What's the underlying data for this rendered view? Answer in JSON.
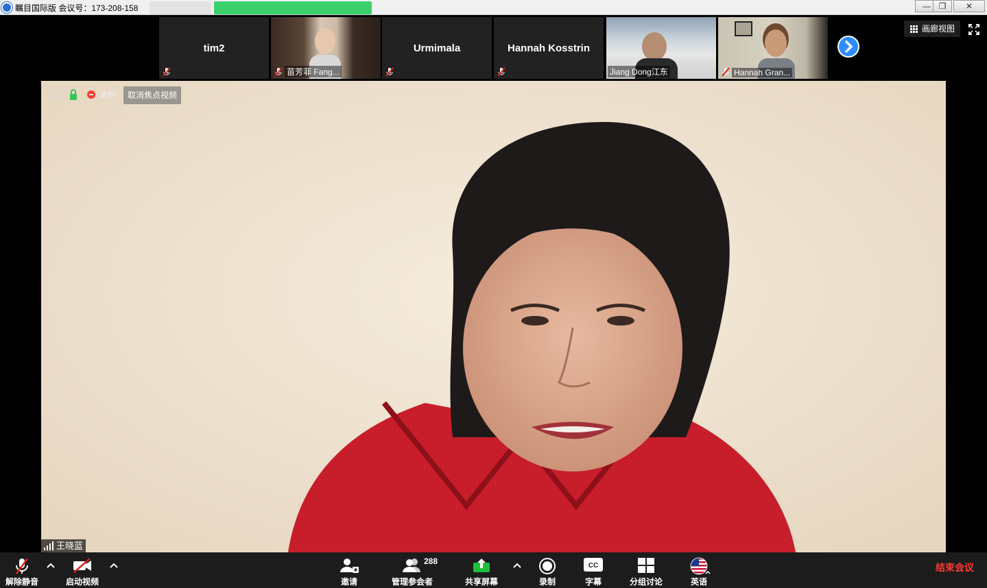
{
  "window": {
    "title": "瞩目国际版 会议号：173-208-158",
    "buttons": {
      "minimize": "—",
      "restore": "❐",
      "close": "✕"
    }
  },
  "strip": {
    "tiles": [
      {
        "name": "tim2",
        "video": false
      },
      {
        "name": "苗芳菲 Fang...",
        "video": true
      },
      {
        "name": "Urmimala",
        "video": false
      },
      {
        "name": "Hannah Kosstrin",
        "video": false
      },
      {
        "name": "Jiang Dong江东",
        "video": true
      },
      {
        "name": "Hannah Gran...",
        "video": true
      }
    ],
    "gallery_label": "画廊视图"
  },
  "main": {
    "recording_label": "录制",
    "unfocus_label": "取消焦点视频",
    "speaker_name": "王晓蓝"
  },
  "toolbar": {
    "unmute": "解除静音",
    "start_video": "启动视频",
    "invite": "邀请",
    "participants": "管理参会者",
    "participants_count": "288",
    "share": "共享屏幕",
    "record": "录制",
    "captions": "字幕",
    "breakout": "分组讨论",
    "language": "英语",
    "end": "结束会议"
  },
  "colors": {
    "accent": "#2d8cff",
    "share_green": "#1fbe3c",
    "end_red": "#ff3b30",
    "toolbar_bg": "#1c1c1c"
  }
}
